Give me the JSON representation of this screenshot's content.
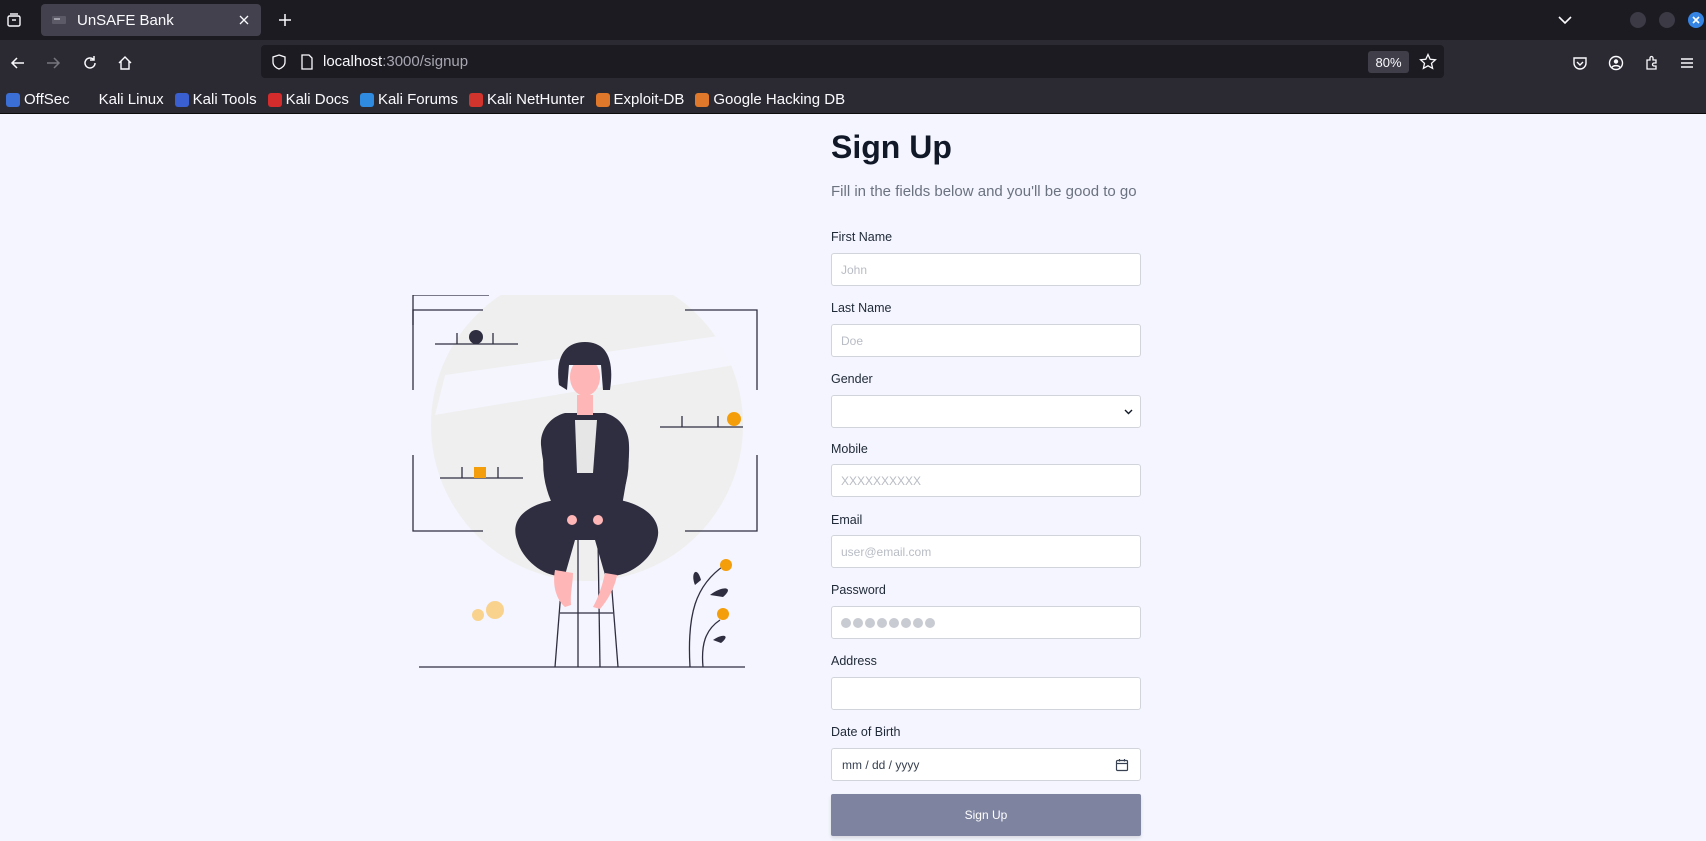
{
  "browser": {
    "tab": {
      "title": "UnSAFE Bank"
    },
    "url": {
      "host": "localhost",
      "path": ":3000/signup"
    },
    "zoom": "80%",
    "bookmarks": [
      {
        "label": "OffSec",
        "color": "#3b6fd6"
      },
      {
        "label": "Kali Linux",
        "color": "#2b2a33"
      },
      {
        "label": "Kali Tools",
        "color": "#3a5fd0"
      },
      {
        "label": "Kali Docs",
        "color": "#d42c2c"
      },
      {
        "label": "Kali Forums",
        "color": "#2e8be0"
      },
      {
        "label": "Kali NetHunter",
        "color": "#d0342c"
      },
      {
        "label": "Exploit-DB",
        "color": "#e0782c"
      },
      {
        "label": "Google Hacking DB",
        "color": "#e0782c"
      }
    ]
  },
  "signup": {
    "title": "Sign Up",
    "subtitle": "Fill in the fields below and you'll be good to go",
    "fields": {
      "first_name": {
        "label": "First Name",
        "placeholder": "John"
      },
      "last_name": {
        "label": "Last Name",
        "placeholder": "Doe"
      },
      "gender": {
        "label": "Gender",
        "value": ""
      },
      "mobile": {
        "label": "Mobile",
        "placeholder": "XXXXXXXXXX"
      },
      "email": {
        "label": "Email",
        "placeholder": "user@email.com"
      },
      "password": {
        "label": "Password"
      },
      "address": {
        "label": "Address",
        "placeholder": ""
      },
      "dob": {
        "label": "Date of Birth",
        "placeholder": "mm / dd / yyyy"
      }
    },
    "submit_label": "Sign Up"
  },
  "colors": {
    "accent": "#f59e0b",
    "figure_dark": "#2f2e41",
    "button": "#7e83a0",
    "page_bg": "#f4f5fe"
  }
}
